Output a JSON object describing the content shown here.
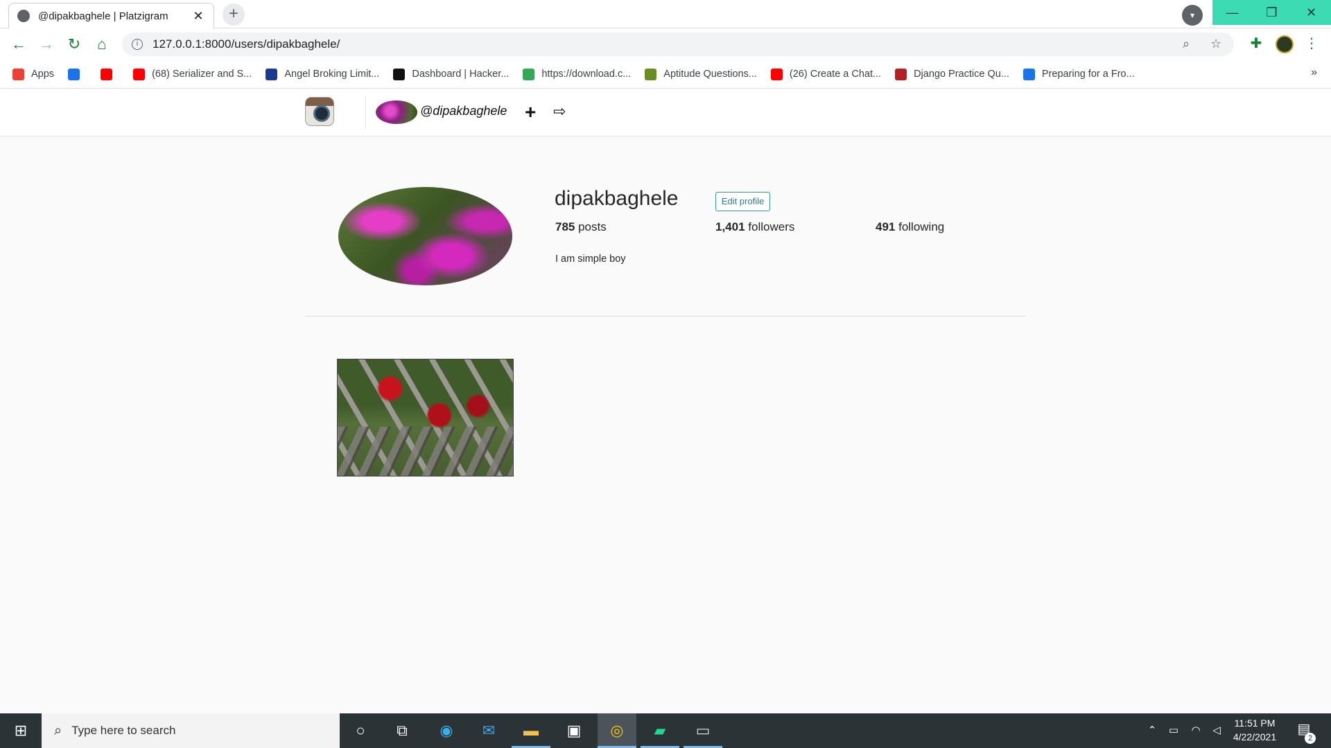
{
  "browser": {
    "tab_title": "@dipakbaghele | Platzigram",
    "tab_close": "✕",
    "new_tab": "+",
    "url": "127.0.0.1:8000/users/dipakbaghele/",
    "window_controls": {
      "minimize": "—",
      "restore": "❐",
      "close": "✕"
    }
  },
  "bookmarks": [
    {
      "label": "Apps",
      "icon": "apps-grid-icon",
      "color": "#ea4335"
    },
    {
      "label": "",
      "icon": "moon-bookmark-icon",
      "color": "#1a73e8"
    },
    {
      "label": "",
      "icon": "youtube-icon",
      "color": "#ff0000"
    },
    {
      "label": "(68) Serializer and S...",
      "icon": "youtube-icon",
      "color": "#ff0000"
    },
    {
      "label": "Angel Broking Limit...",
      "icon": "d-icon",
      "color": "#1a3a8f"
    },
    {
      "label": "Dashboard | Hacker...",
      "icon": "hackerrank-icon",
      "color": "#111111"
    },
    {
      "label": "https://download.c...",
      "icon": "globe-icon",
      "color": "#34a853"
    },
    {
      "label": "Aptitude Questions...",
      "icon": "bird-icon",
      "color": "#6b8e23"
    },
    {
      "label": "(26) Create a Chat...",
      "icon": "youtube-icon",
      "color": "#ff0000"
    },
    {
      "label": "Django Practice Qu...",
      "icon": "ship-icon",
      "color": "#b22222"
    },
    {
      "label": "Preparing for a Fro...",
      "icon": "circle-icon",
      "color": "#1a73e8"
    }
  ],
  "bookmarks_more": "»",
  "site_nav": {
    "username": "@dipakbaghele",
    "add_icon": "+",
    "logout_icon": "⇨"
  },
  "profile": {
    "username": "dipakbaghele",
    "edit_label": "Edit profile",
    "posts_count": "785",
    "posts_label": " posts",
    "followers_count": "1,401",
    "followers_label": " followers",
    "following_count": "491",
    "following_label": " following",
    "bio": "I am simple boy"
  },
  "taskbar": {
    "search_placeholder": "Type here to search",
    "time": "11:51 PM",
    "date": "4/22/2021",
    "notifications": "2"
  },
  "colors": {
    "accent_teal": "#3ddbb3",
    "edit_button": "#3897a1",
    "taskbar": "#2b3337"
  }
}
